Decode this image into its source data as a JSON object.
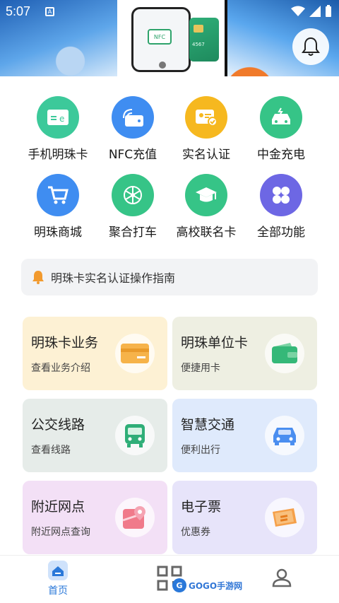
{
  "status_bar": {
    "time": "5:07",
    "notif_badge": "A"
  },
  "banner": {
    "nfc_text": "NFC",
    "card_number": "4567"
  },
  "grid": [
    {
      "label": "手机明珠卡",
      "icon": "card-e-icon",
      "color": "#3cc99a"
    },
    {
      "label": "NFC充值",
      "icon": "nfc-wallet-icon",
      "color": "#3f8df1"
    },
    {
      "label": "实名认证",
      "icon": "id-verify-icon",
      "color": "#f6b81f"
    },
    {
      "label": "中金充电",
      "icon": "car-charging-icon",
      "color": "#36c487"
    },
    {
      "label": "明珠商城",
      "icon": "cart-icon",
      "color": "#3f8df1"
    },
    {
      "label": "聚合打车",
      "icon": "network-icon",
      "color": "#36c487"
    },
    {
      "label": "高校联名卡",
      "icon": "graduation-cap-icon",
      "color": "#36c487"
    },
    {
      "label": "全部功能",
      "icon": "four-dots-icon",
      "color": "#6d67e4"
    }
  ],
  "notice": {
    "text": "明珠卡实名认证操作指南"
  },
  "cards": [
    {
      "title": "明珠卡业务",
      "subtitle": "查看业务介绍",
      "icon": "orange-card-icon",
      "bg": "#fdf1d4"
    },
    {
      "title": "明珠单位卡",
      "subtitle": "便捷用卡",
      "icon": "green-wallet-icon",
      "bg": "#eeefe2"
    },
    {
      "title": "公交线路",
      "subtitle": "查看线路",
      "icon": "bus-icon",
      "bg": "#e6ece9"
    },
    {
      "title": "智慧交通",
      "subtitle": "便利出行",
      "icon": "car-icon",
      "bg": "#dfeafc"
    },
    {
      "title": "附近网点",
      "subtitle": "附近网点查询",
      "icon": "map-pin-icon",
      "bg": "#f3e0f6"
    },
    {
      "title": "电子票",
      "subtitle": "优惠券",
      "icon": "ticket-icon",
      "bg": "#e7e4fa"
    }
  ],
  "bottom_nav": {
    "home_label": "首页"
  },
  "watermark": {
    "badge": "G",
    "text": "GOGO手游网"
  }
}
